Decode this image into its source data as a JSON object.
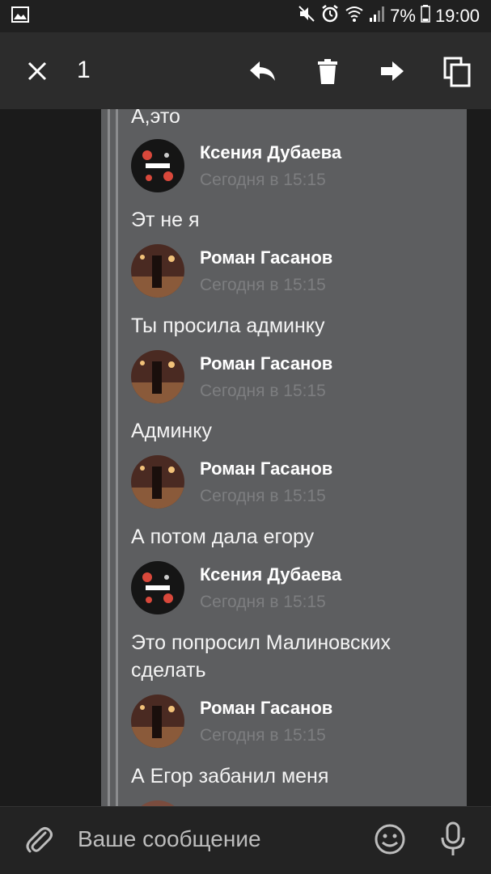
{
  "status_bar": {
    "battery": "7%",
    "time": "19:00",
    "icons": [
      "image-icon",
      "mute-icon",
      "alarm-icon",
      "wifi-icon",
      "signal-icon",
      "battery-icon"
    ]
  },
  "action_bar": {
    "selected_count": "1",
    "icons": [
      "close-icon",
      "reply-icon",
      "delete-icon",
      "forward-icon",
      "copy-icon"
    ]
  },
  "messages": {
    "m0": "А,это",
    "a1": {
      "name": "Ксения Дубаева",
      "time": "Сегодня в 15:15"
    },
    "m1": "Эт не я",
    "a2": {
      "name": "Роман Гасанов",
      "time": "Сегодня в 15:15"
    },
    "m2": "Ты просила админку",
    "a3": {
      "name": "Роман Гасанов",
      "time": "Сегодня в 15:15"
    },
    "m3": "Админку",
    "a4": {
      "name": "Роман Гасанов",
      "time": "Сегодня в 15:15"
    },
    "m4": "А потом дала егору",
    "a5": {
      "name": "Ксения Дубаева",
      "time": "Сегодня в 15:15"
    },
    "m5": "Это попросил Малиновских сделать",
    "a6": {
      "name": "Роман Гасанов",
      "time": "Сегодня в 15:15"
    },
    "m6": "А Егор забанил меня"
  },
  "composer": {
    "placeholder": "Ваше сообщение",
    "icons": [
      "attach-icon",
      "emoji-icon",
      "microphone-icon"
    ]
  },
  "colors": {
    "quote_bg": "#5d5e60",
    "action_bar_bg": "#2c2c2c",
    "timestamp": "#7d7e80"
  }
}
